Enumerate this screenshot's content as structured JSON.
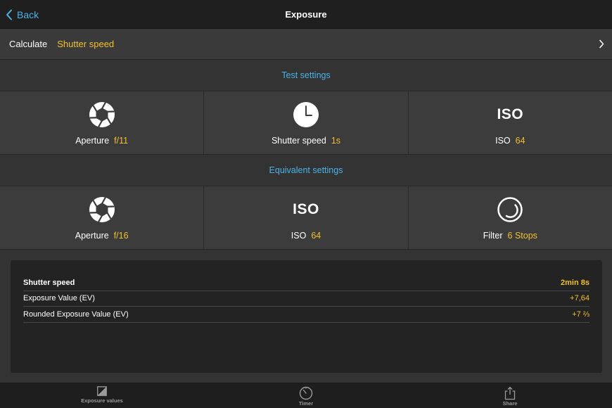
{
  "nav": {
    "back_label": "Back",
    "title": "Exposure"
  },
  "calculate": {
    "label": "Calculate",
    "value": "Shutter speed"
  },
  "test_settings": {
    "header": "Test settings",
    "aperture": {
      "label": "Aperture",
      "value": "f/11"
    },
    "shutter": {
      "label": "Shutter speed",
      "value": "1s"
    },
    "iso": {
      "icon_text": "ISO",
      "label": "ISO",
      "value": "64"
    }
  },
  "equivalent_settings": {
    "header": "Equivalent settings",
    "aperture": {
      "label": "Aperture",
      "value": "f/16"
    },
    "iso": {
      "icon_text": "ISO",
      "label": "ISO",
      "value": "64"
    },
    "filter": {
      "label": "Filter",
      "value": "6 Stops"
    }
  },
  "results": [
    {
      "key": "Shutter speed",
      "value": "2min 8s"
    },
    {
      "key": "Exposure Value (EV)",
      "value": "+7,64"
    },
    {
      "key": "Rounded Exposure Value (EV)",
      "value": "+7 ⅔"
    }
  ],
  "tabs": {
    "exposure_values": "Exposure values",
    "timer": "Timer",
    "share": "Share"
  },
  "colors": {
    "accent_blue": "#4ab3e8",
    "value_yellow": "#f2c02e",
    "background": "#333333"
  }
}
